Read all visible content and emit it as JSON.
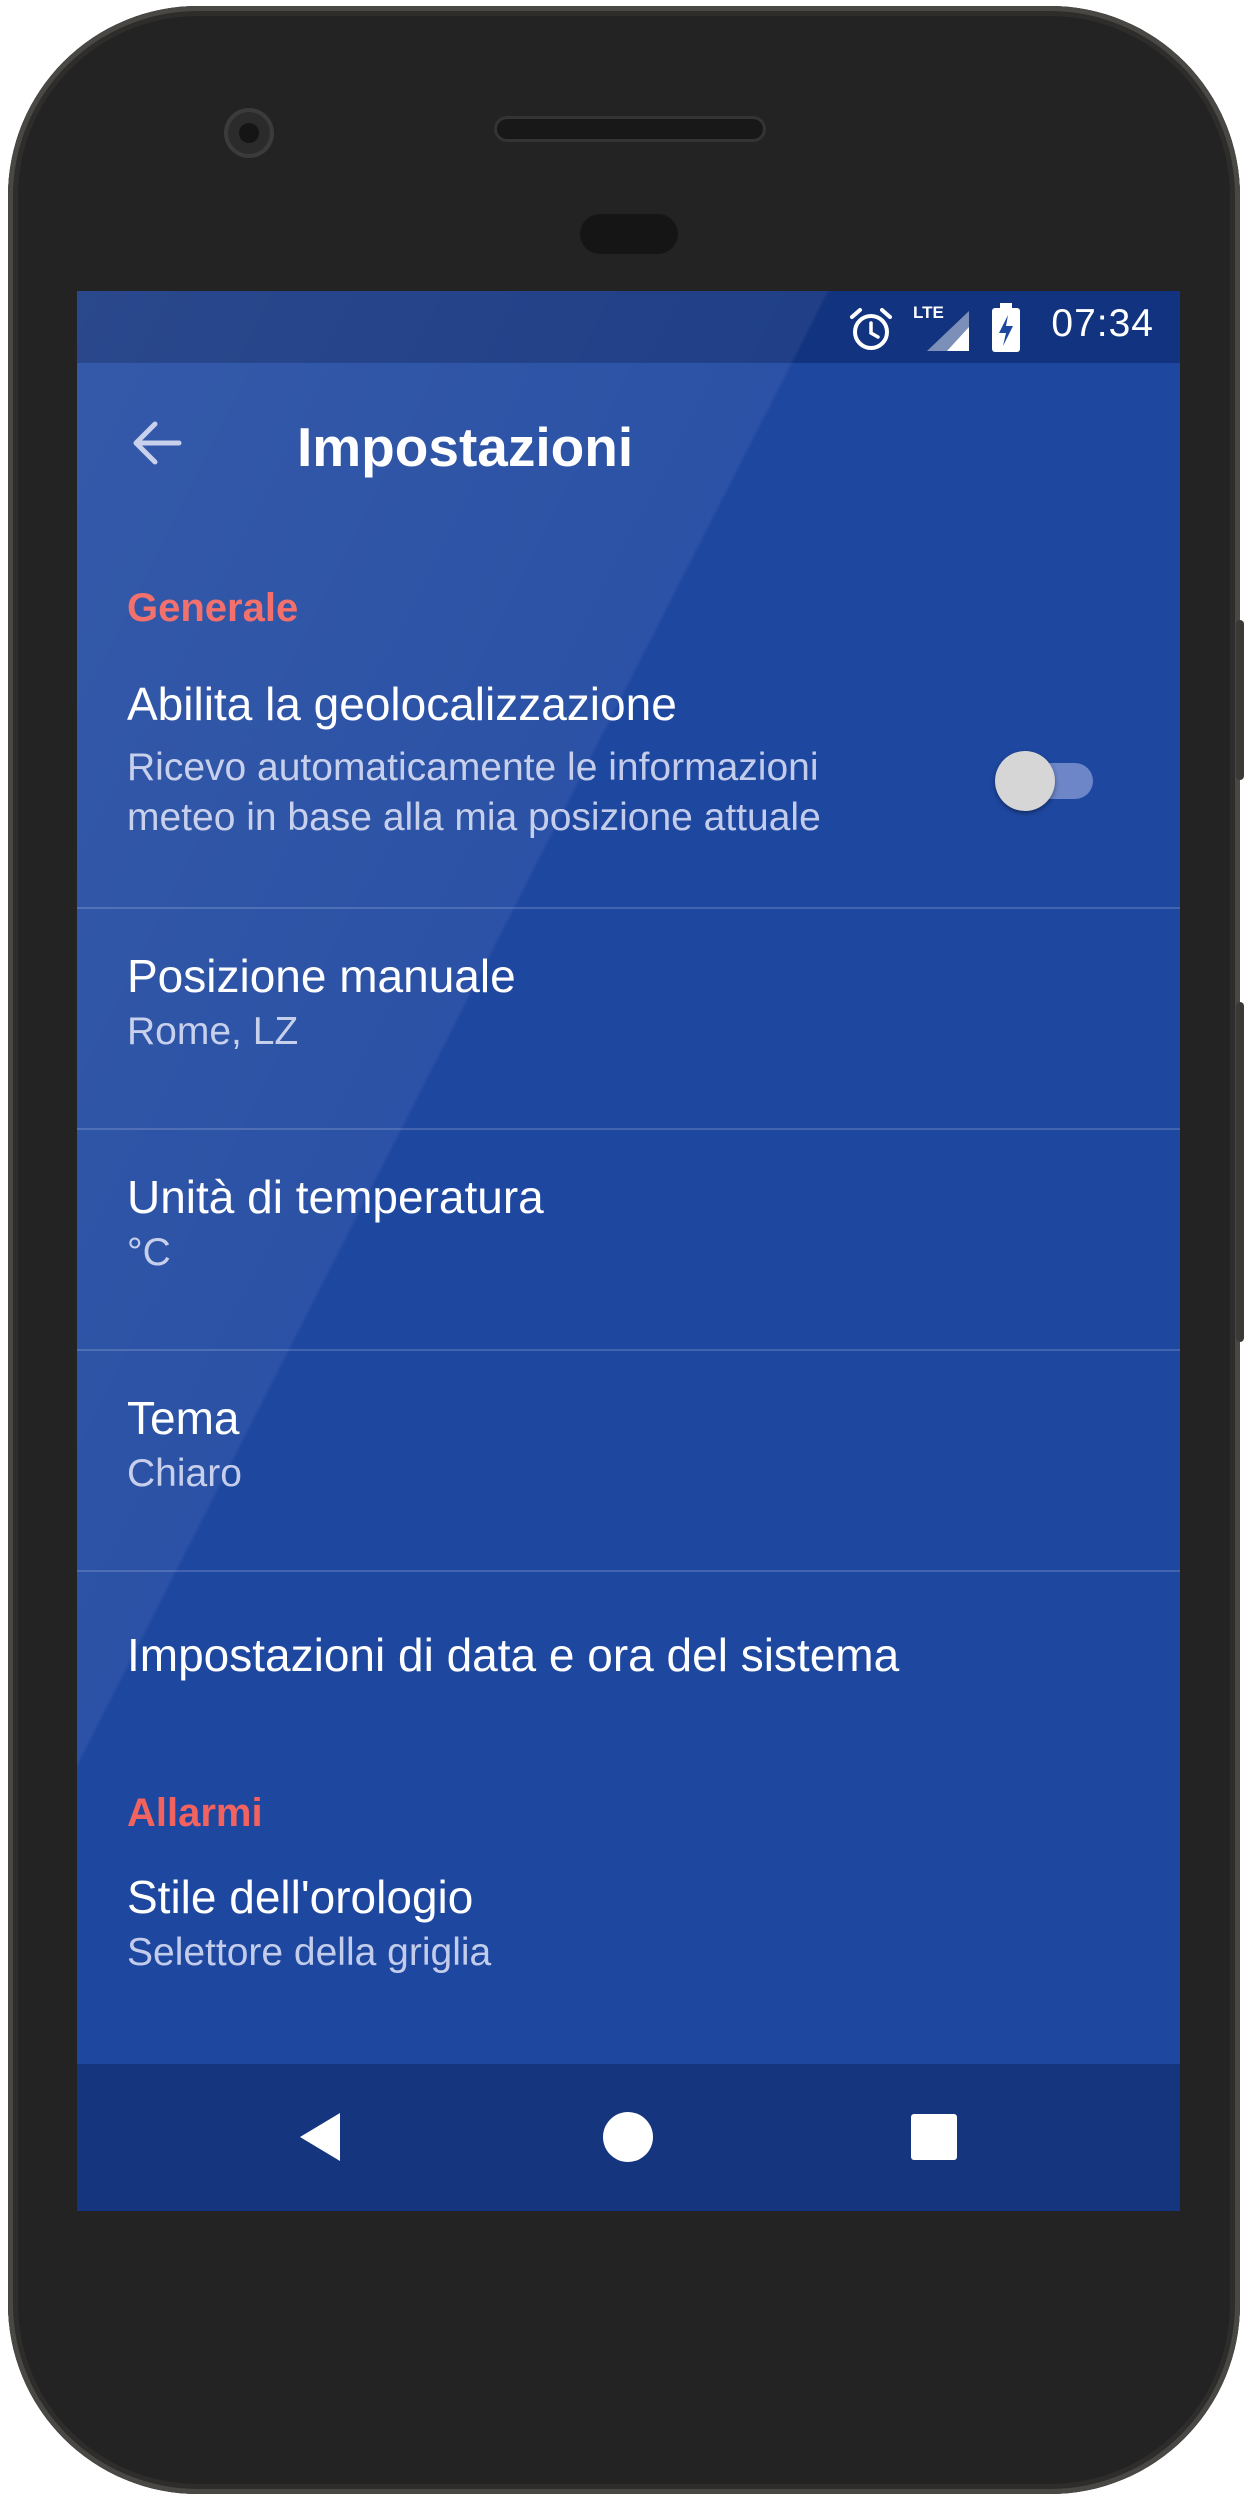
{
  "status_bar": {
    "time": "07:34",
    "network_label": "LTE",
    "icons": [
      "alarm-clock-icon",
      "lte-signal-icon",
      "battery-charging-icon"
    ]
  },
  "app_bar": {
    "title": "Impostazioni",
    "back_icon": "arrow-left-icon"
  },
  "sections": {
    "general": {
      "header": "Generale",
      "geolocation": {
        "title": "Abilita la geolocalizzazione",
        "summary_line1": "Ricevo automaticamente le informazioni",
        "summary_line2": "meteo in base alla mia posizione attuale",
        "enabled": false
      },
      "manual_location": {
        "title": "Posizione manuale",
        "summary": "Rome, LZ"
      },
      "temperature_unit": {
        "title": "Unità di temperatura",
        "summary": "°C"
      },
      "theme": {
        "title": "Tema",
        "summary": "Chiaro"
      },
      "date_time": {
        "title": "Impostazioni di data e ora del sistema"
      }
    },
    "alarms": {
      "header": "Allarmi",
      "clock_style": {
        "title": "Stile dell'orologio",
        "summary": "Selettore della griglia"
      }
    }
  },
  "nav_bar": {
    "icons": [
      "nav-back-icon",
      "nav-home-icon",
      "nav-recents-icon"
    ]
  },
  "colors": {
    "screen_background": "#1e47a0",
    "section_header": "#f2635f",
    "summary_text": "#c3ccea",
    "nav_bar": "#15357f"
  }
}
